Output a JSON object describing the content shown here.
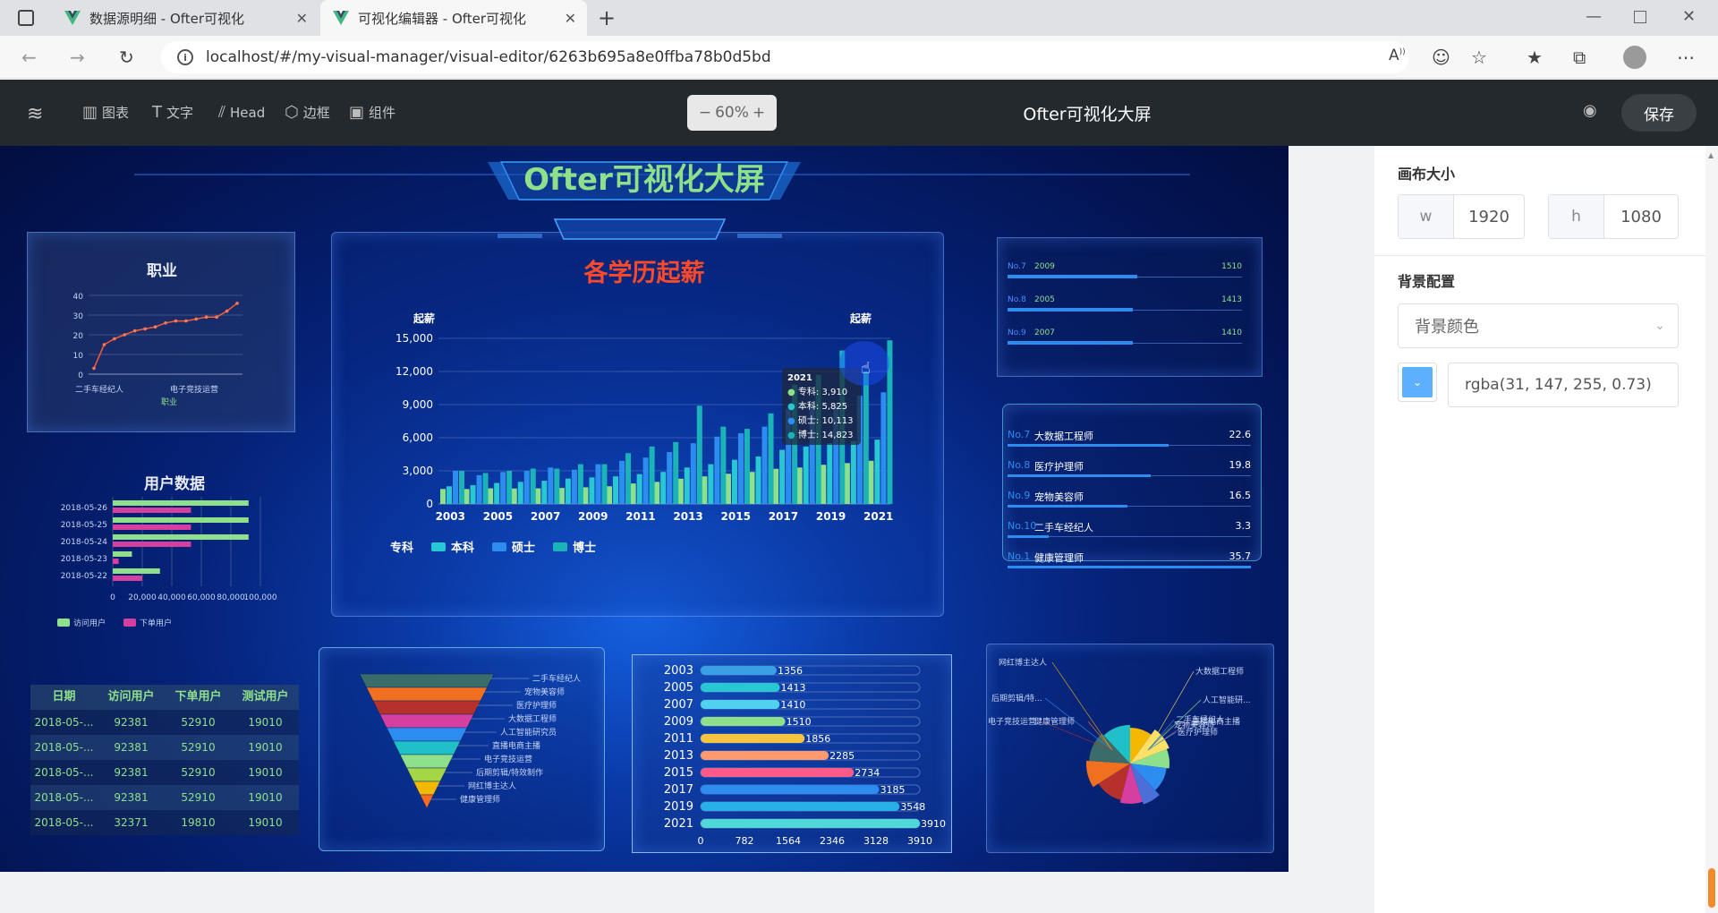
{
  "browser": {
    "tabs": [
      {
        "title": "数据源明细 - Ofter可视化"
      },
      {
        "title": "可视化编辑器 - Ofter可视化"
      }
    ],
    "url": "localhost/#/my-visual-manager/visual-editor/6263b695a8e0ffba78b0d5bd"
  },
  "toolbar": {
    "items": [
      "图表",
      "文字",
      "Head",
      "边框",
      "组件"
    ],
    "zoom": "60%",
    "title": "Ofter可视化大屏",
    "save_label": "保存"
  },
  "screen": {
    "title": "Ofter可视化大屏",
    "colors": {
      "green": "#8fe08a",
      "cyan": "#27c7d4",
      "blue": "#2c8cf0",
      "teal": "#1ab3b8",
      "red": "#ff4a2a"
    }
  },
  "panels": {
    "job": {
      "title": "职业",
      "xlabels": [
        "二手车经纪人",
        "电子竞技运营"
      ],
      "xname": "职业",
      "yticks": [
        "40",
        "30",
        "20",
        "10",
        "0"
      ]
    },
    "users": {
      "title": "用户数据",
      "dates": [
        "2018-05-26",
        "2018-05-25",
        "2018-05-24",
        "2018-05-23",
        "2018-05-22"
      ],
      "xticks": [
        "0",
        "20,000",
        "40,000",
        "60,000",
        "80,000",
        "100,000"
      ],
      "legend": [
        "访问用户",
        "下单用户"
      ]
    },
    "table": {
      "headers": [
        "日期",
        "访问用户",
        "下单用户",
        "测试用户"
      ],
      "rows": [
        [
          "2018-05-...",
          "92381",
          "52910",
          "19010"
        ],
        [
          "2018-05-...",
          "92381",
          "52910",
          "19010"
        ],
        [
          "2018-05-...",
          "92381",
          "52910",
          "19010"
        ],
        [
          "2018-05-...",
          "92381",
          "52910",
          "19010"
        ],
        [
          "2018-05-...",
          "32371",
          "19810",
          "19010"
        ]
      ]
    },
    "salary": {
      "title": "各学历起薪",
      "y_left": "起薪",
      "y_right": "起薪",
      "tooltip": {
        "year": "2021",
        "lines": [
          "专科: 3,910",
          "本科: 5,825",
          "硕士: 10,113",
          "博士: 14,823"
        ]
      }
    },
    "rank_top": [
      {
        "no": "No.7",
        "year": "2009",
        "value": "1510"
      },
      {
        "no": "No.8",
        "year": "2005",
        "value": "1413"
      },
      {
        "no": "No.9",
        "year": "2007",
        "value": "1410"
      }
    ],
    "rank_mid": [
      {
        "no": "No.7",
        "name": "大数据工程师",
        "value": "22.6"
      },
      {
        "no": "No.8",
        "name": "医疗护理师",
        "value": "19.8"
      },
      {
        "no": "No.9",
        "name": "宠物美容师",
        "value": "16.5"
      },
      {
        "no": "No.10",
        "name": "二手车经纪人",
        "value": "3.3"
      },
      {
        "no": "No.1",
        "name": "健康管理师",
        "value": "35.7"
      }
    ],
    "funnel": {
      "labels": [
        "二手车经纪人",
        "宠物美容师",
        "医疗护理师",
        "大数据工程师",
        "人工智能研究员",
        "直播电商主播",
        "电子竞技运营",
        "后期剪辑/特效制作",
        "网红博主达人",
        "健康管理师"
      ]
    },
    "hbar": {
      "years": [
        "2003",
        "2005",
        "2007",
        "2009",
        "2011",
        "2013",
        "2015",
        "2017",
        "2019",
        "2021"
      ],
      "labels": [
        "1356",
        "1413",
        "1410",
        "1510",
        "1856",
        "2285",
        "2734",
        "3185",
        "3548",
        "3910"
      ],
      "xticks": [
        "0",
        "782",
        "1564",
        "2346",
        "3128",
        "3910"
      ]
    },
    "pie": {
      "labels": [
        "网红博主达人",
        "大数据工程师",
        "人工智能研...",
        "后期剪辑/特...",
        "二手车经纪人",
        "直播电商主播",
        "电子竞技运营",
        "健康管理师",
        "宠物美容师",
        "医疗护理师"
      ]
    }
  },
  "chart_data": [
    {
      "type": "bar",
      "title": "各学历起薪",
      "ylabel": "起薪",
      "categories": [
        "2003",
        "2004",
        "2005",
        "2006",
        "2007",
        "2008",
        "2009",
        "2010",
        "2011",
        "2012",
        "2013",
        "2014",
        "2015",
        "2016",
        "2017",
        "2018",
        "2019",
        "2020",
        "2021"
      ],
      "xticks": [
        "2003",
        "2005",
        "2007",
        "2009",
        "2011",
        "2013",
        "2015",
        "2017",
        "2019",
        "2021"
      ],
      "yticks": [
        "15,000",
        "12,000",
        "9,000",
        "6,000",
        "3,000",
        "0"
      ],
      "ylim": [
        0,
        15000
      ],
      "series": [
        {
          "name": "专科",
          "color": "#8fe08a",
          "values": [
            1356,
            1350,
            1413,
            1400,
            1410,
            1450,
            1510,
            1600,
            1856,
            2000,
            2285,
            2500,
            2734,
            2900,
            3185,
            3300,
            3548,
            3700,
            3910
          ]
        },
        {
          "name": "本科",
          "color": "#27c7d4",
          "values": [
            1600,
            1700,
            1900,
            2000,
            2100,
            2300,
            2400,
            2500,
            2700,
            2900,
            3300,
            3600,
            4000,
            4300,
            4900,
            5200,
            5500,
            5700,
            5825
          ]
        },
        {
          "name": "硕士",
          "color": "#2c8cf0",
          "values": [
            3000,
            2600,
            2900,
            3000,
            3300,
            3100,
            3600,
            3900,
            4200,
            4700,
            5500,
            6100,
            6400,
            7000,
            8600,
            9200,
            9000,
            9800,
            10113
          ]
        },
        {
          "name": "博士",
          "color": "#1ab3b8",
          "values": [
            3000,
            2800,
            3000,
            3200,
            3200,
            3600,
            3600,
            4600,
            5200,
            5600,
            8900,
            7000,
            6800,
            8200,
            10800,
            11700,
            13900,
            12000,
            14823
          ]
        }
      ]
    },
    {
      "type": "line",
      "title": "职业",
      "xlabel": "职业",
      "ylim": [
        0,
        40
      ],
      "values": [
        3,
        15,
        18,
        20,
        22,
        23,
        24,
        26,
        27,
        27,
        28,
        29,
        29,
        32,
        36
      ]
    },
    {
      "type": "bar",
      "title": "用户数据",
      "categories": [
        "2018-05-26",
        "2018-05-25",
        "2018-05-24",
        "2018-05-23",
        "2018-05-22"
      ],
      "xlim": [
        0,
        100000
      ],
      "series": [
        {
          "name": "访问用户",
          "color": "#8fe08a",
          "values": [
            92000,
            92000,
            92000,
            13000,
            32000
          ]
        },
        {
          "name": "下单用户",
          "color": "#d43fa0",
          "values": [
            53000,
            53000,
            53000,
            4000,
            20000
          ]
        }
      ]
    },
    {
      "type": "bar",
      "categories": [
        "2003",
        "2005",
        "2007",
        "2009",
        "2011",
        "2013",
        "2015",
        "2017",
        "2019",
        "2021"
      ],
      "values": [
        1356,
        1413,
        1410,
        1510,
        1856,
        2285,
        2734,
        3185,
        3548,
        3910
      ],
      "xlim": [
        0,
        3910
      ]
    },
    {
      "type": "pie",
      "labels": [
        "网红博主达人",
        "大数据工程师",
        "人工智能研...",
        "后期剪辑/特...",
        "二手车经纪人",
        "直播电商主播",
        "电子竞技运营",
        "健康管理师",
        "宠物美容师",
        "医疗护理师"
      ],
      "values": [
        10,
        9,
        8,
        11,
        7,
        9,
        12,
        10,
        12,
        12
      ],
      "colors": [
        "#f5b800",
        "#ffe066",
        "#8fe08a",
        "#2c8cf0",
        "#4a6fd8",
        "#d43fa0",
        "#b7312c",
        "#f07020",
        "#3a6c6a",
        "#20c0c8"
      ]
    }
  ],
  "sidebar": {
    "canvas_size_label": "画布大小",
    "w_label": "w",
    "w_value": "1920",
    "h_label": "h",
    "h_value": "1080",
    "bg_label": "背景配置",
    "bg_select": "背景颜色",
    "color_value": "rgba(31, 147, 255, 0.73)"
  }
}
